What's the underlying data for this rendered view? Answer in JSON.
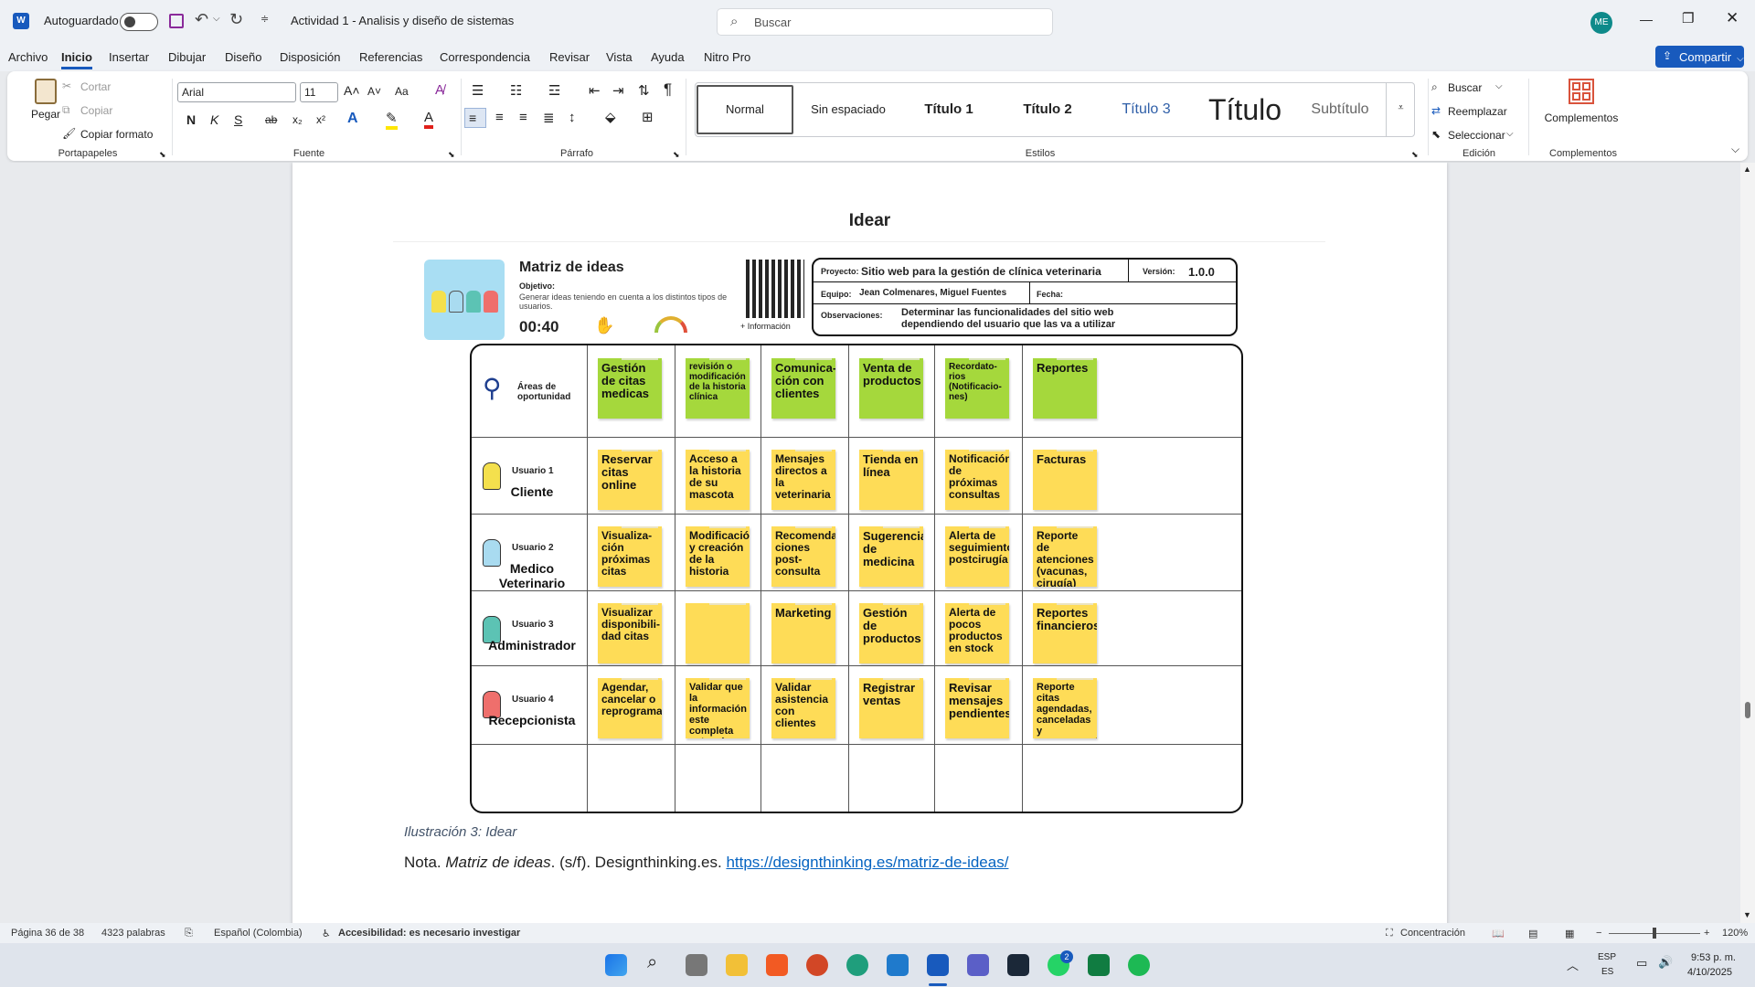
{
  "app": {
    "autosave_label": "Autoguardado",
    "doc_title": "Actividad 1 - Analisis y diseño de sistemas",
    "search_placeholder": "Buscar",
    "avatar": "ME",
    "accent": "#185abd"
  },
  "tabs": [
    "Archivo",
    "Inicio",
    "Insertar",
    "Dibujar",
    "Diseño",
    "Disposición",
    "Referencias",
    "Correspondencia",
    "Revisar",
    "Vista",
    "Ayuda",
    "Nitro Pro"
  ],
  "share_label": "Compartir",
  "ribbon": {
    "clipboard": {
      "paste": "Pegar",
      "cut": "Cortar",
      "copy": "Copiar",
      "format_painter": "Copiar formato",
      "group": "Portapapeles"
    },
    "font": {
      "name": "Arial",
      "size": "11",
      "group": "Fuente",
      "case": "Aa",
      "bold": "N",
      "italic": "K",
      "underline": "S",
      "strike": "ab",
      "sub": "x₂",
      "sup": "x²"
    },
    "paragraph": {
      "group": "Párrafo"
    },
    "styles": {
      "group": "Estilos",
      "items": [
        "Normal",
        "Sin espaciado",
        "Título 1",
        "Título 2",
        "Título 3",
        "Título",
        "Subtítulo"
      ]
    },
    "editing": {
      "group": "Edición",
      "find": "Buscar",
      "replace": "Reemplazar",
      "select": "Seleccionar"
    },
    "addins": {
      "group": "Complementos",
      "label": "Complementos"
    }
  },
  "document": {
    "heading": "Idear",
    "matrix_title": "Matriz de ideas",
    "objective_label": "Objetivo:",
    "objective_text": "Generar ideas teniendo en cuenta a los distintos tipos de usuarios.",
    "timer": "00:40",
    "qr_label": "+ Información",
    "project_label": "Proyecto:",
    "project_value": "Sitio web para la gestión de clínica veterinaria",
    "version_label": "Versión:",
    "version_value": "1.0.0",
    "team_label": "Equipo:",
    "team_value": "Jean Colmenares, Miguel Fuentes",
    "date_label": "Fecha:",
    "obs_label": "Observaciones:",
    "obs_value": "Determinar las funcionalidades del sitio web dependiendo del usuario que las va a utilizar",
    "areas_label": "Áreas de oportunidad",
    "areas": [
      "Gestión de citas medicas",
      "revisión o modificación de la historia clínica",
      "Comunica-ción con clientes",
      "Venta de productos",
      "Recordato-rios (Notificacio-nes)",
      "Reportes"
    ],
    "users": [
      {
        "tag": "Usuario 1",
        "name": "Cliente",
        "color": "#f4e04d",
        "ideas": [
          "Reservar citas online",
          "Acceso a la historia de su mascota",
          "Mensajes directos a la veterinaria",
          "Tienda en línea",
          "Notificación de próximas consultas",
          "Facturas"
        ]
      },
      {
        "tag": "Usuario 2",
        "name": "Medico Veterinario",
        "color": "#a9dbf0",
        "ideas": [
          "Visualiza-ción próximas citas",
          "Modificación y creación de la historia",
          "Recomenda ciones post-consulta",
          "Sugerencia de medicina",
          "Alerta de seguimiento postcirugía",
          "Reporte de atenciones (vacunas, cirugía)"
        ]
      },
      {
        "tag": "Usuario 3",
        "name": "Administrador",
        "color": "#5cc3b4",
        "ideas": [
          "Visualizar disponibili-dad citas",
          "",
          "Marketing",
          "Gestión de productos",
          "Alerta de pocos productos en stock",
          "Reportes financieros"
        ]
      },
      {
        "tag": "Usuario 4",
        "name": "Recepcionista",
        "color": "#ef6f6c",
        "ideas": [
          "Agendar, cancelar o reprogramar",
          "Validar que la información este completa antes de consulta",
          "Validar asistencia con clientes",
          "Registrar ventas",
          "Revisar mensajes pendientes",
          "Reporte citas agendadas, canceladas y reprogramadas"
        ]
      }
    ],
    "caption": "Ilustración 3: Idear",
    "note_prefix": "Nota. ",
    "note_title": "Matriz de ideas",
    "note_rest": ". (s/f). Designthinking.es. ",
    "note_link": "https://designthinking.es/matriz-de-ideas/"
  },
  "status": {
    "page": "Página 36 de 38",
    "words": "4323 palabras",
    "language": "Español (Colombia)",
    "accessibility": "Accesibilidad: es necesario investigar",
    "focus": "Concentración",
    "zoom": "120%"
  },
  "taskbar": {
    "lang1": "ESP",
    "lang2": "ES",
    "time": "9:53 p. m.",
    "date": "4/10/2025",
    "badge": "2"
  }
}
